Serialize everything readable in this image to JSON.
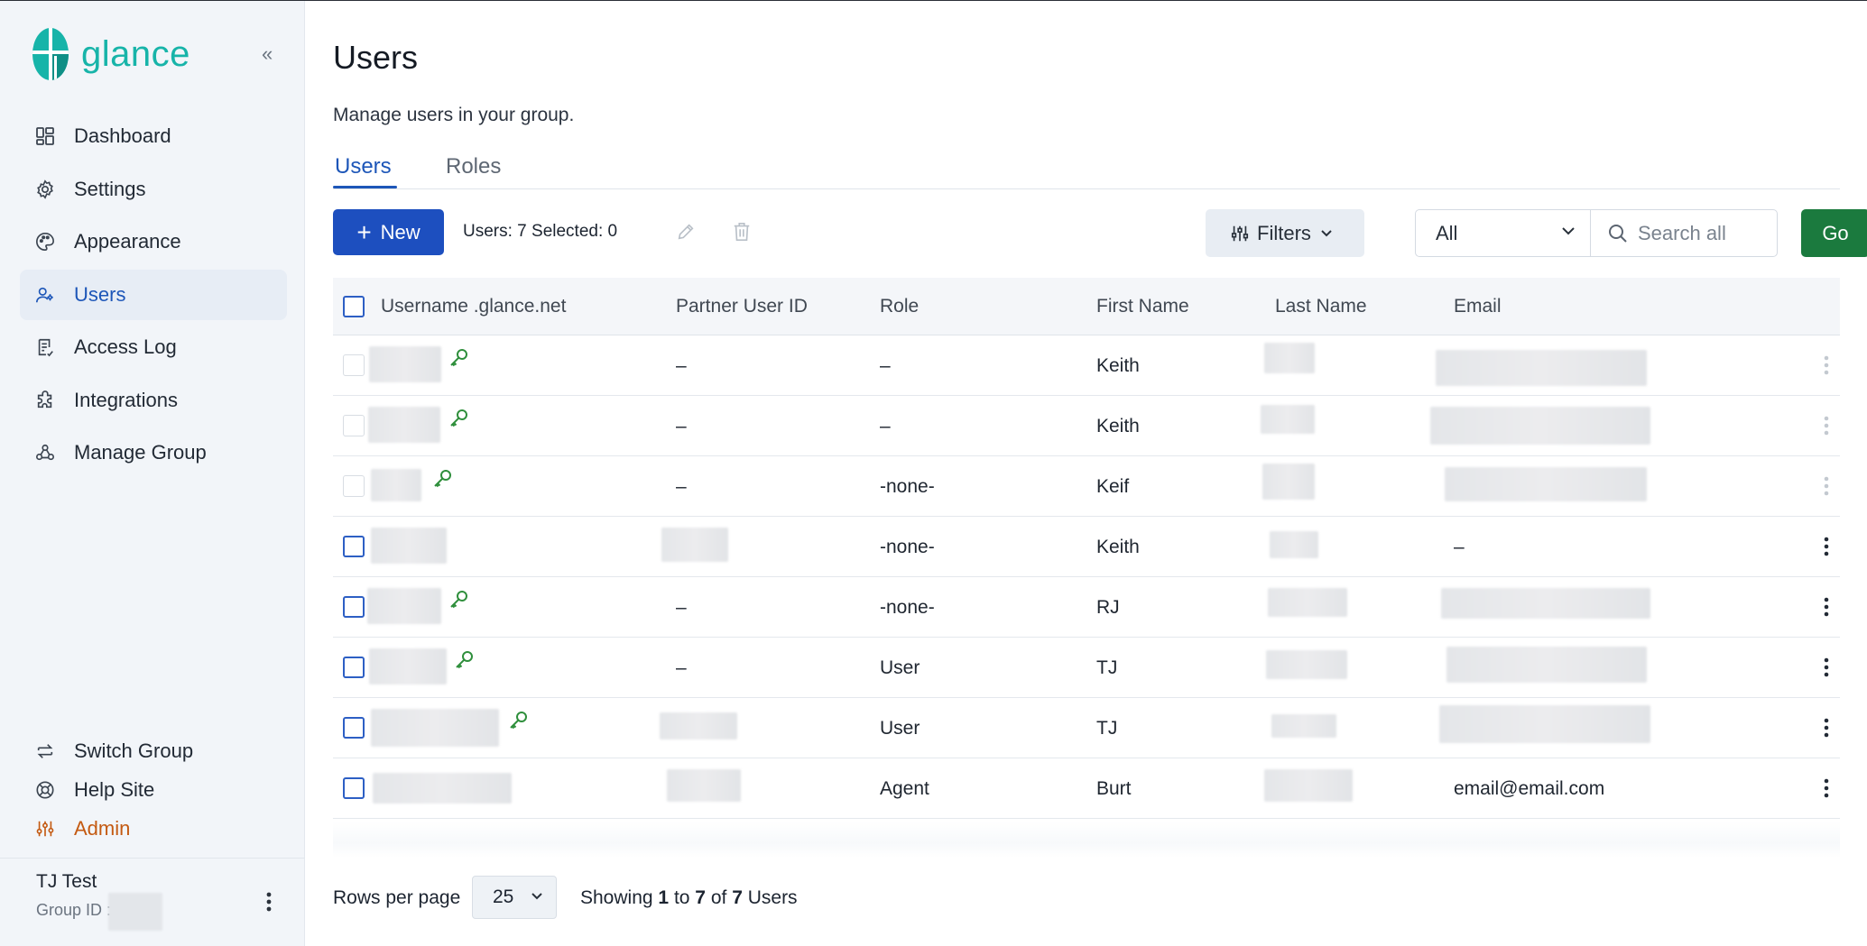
{
  "app": {
    "logo_text": "glance",
    "brand_color": "#17b4a9",
    "accent_color": "#1d56b8"
  },
  "sidebar": {
    "collapse_icon": "«",
    "items": [
      {
        "label": "Dashboard",
        "icon": "dashboard-icon"
      },
      {
        "label": "Settings",
        "icon": "gear-icon"
      },
      {
        "label": "Appearance",
        "icon": "palette-icon"
      },
      {
        "label": "Users",
        "icon": "users-icon",
        "active": true
      },
      {
        "label": "Access Log",
        "icon": "log-icon"
      },
      {
        "label": "Integrations",
        "icon": "puzzle-icon"
      },
      {
        "label": "Manage Group",
        "icon": "group-icon"
      }
    ],
    "bottom_items": [
      {
        "label": "Switch Group",
        "icon": "switch-icon"
      },
      {
        "label": "Help Site",
        "icon": "lifebuoy-icon"
      },
      {
        "label": "Admin",
        "icon": "sliders-icon",
        "color": "#c45a12"
      }
    ],
    "user": {
      "name": "TJ Test",
      "group_label": "Group ID :"
    }
  },
  "page": {
    "title": "Users",
    "subtitle": "Manage users in your group.",
    "tabs": [
      {
        "label": "Users",
        "active": true
      },
      {
        "label": "Roles",
        "active": false
      }
    ]
  },
  "toolbar": {
    "new_label": "New",
    "count_text": "Users: 7 Selected: 0",
    "filters_label": "Filters",
    "scope_value": "All",
    "search_placeholder": "Search all",
    "go_label": "Go",
    "go_color": "#1b7a3e"
  },
  "table": {
    "columns": [
      "Username .glance.net",
      "Partner User ID",
      "Role",
      "First Name",
      "Last Name",
      "Email"
    ],
    "rows": [
      {
        "partner_id": "–",
        "role": "–",
        "first_name": "Keith",
        "email": "",
        "selectable": false,
        "has_key": true
      },
      {
        "partner_id": "–",
        "role": "–",
        "first_name": "Keith",
        "email": "",
        "selectable": false,
        "has_key": true
      },
      {
        "partner_id": "–",
        "role": "-none-",
        "first_name": "Keif",
        "email": "",
        "selectable": false,
        "has_key": true
      },
      {
        "partner_id": "",
        "role": "-none-",
        "first_name": "Keith",
        "email": "–",
        "selectable": true,
        "has_key": false
      },
      {
        "partner_id": "–",
        "role": "-none-",
        "first_name": "RJ",
        "email": "",
        "selectable": true,
        "has_key": true
      },
      {
        "partner_id": "–",
        "role": "User",
        "first_name": "TJ",
        "email": "",
        "selectable": true,
        "has_key": true
      },
      {
        "partner_id": "",
        "role": "User",
        "first_name": "TJ",
        "email": "",
        "selectable": true,
        "has_key": true
      },
      {
        "partner_id": "",
        "role": "Agent",
        "first_name": "Burt",
        "email": "email@email.com",
        "selectable": true,
        "has_key": false
      }
    ]
  },
  "pagination": {
    "rows_label": "Rows per page",
    "rows_value": "25",
    "showing_prefix": "Showing",
    "from": "1",
    "to_word": "to",
    "to": "7",
    "of_word": "of",
    "total": "7",
    "suffix": "Users"
  }
}
